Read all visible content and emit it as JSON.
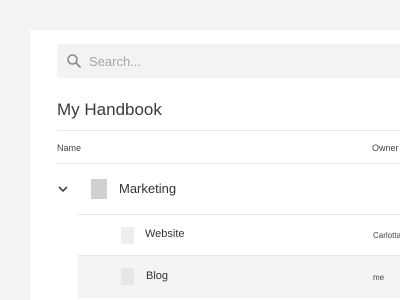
{
  "search": {
    "placeholder": "Search..."
  },
  "page_title": "My Handbook",
  "table": {
    "columns": {
      "name": "Name",
      "owner": "Owner"
    },
    "rows": [
      {
        "label": "Marketing",
        "owner": "",
        "expanded": true,
        "icon": "chevron-down-icon"
      },
      {
        "label": "Website",
        "owner": "Carlotta"
      },
      {
        "label": "Blog",
        "owner": "me"
      }
    ]
  },
  "colors": {
    "background": "#f3f3f3",
    "card": "#ffffff",
    "search_bg": "#f3f3f3",
    "divider": "#e6e6e6",
    "selected_row": "#f4f4f4",
    "folder_thumb": "#d0d0d0",
    "doc_thumb": "#eeeeee"
  }
}
